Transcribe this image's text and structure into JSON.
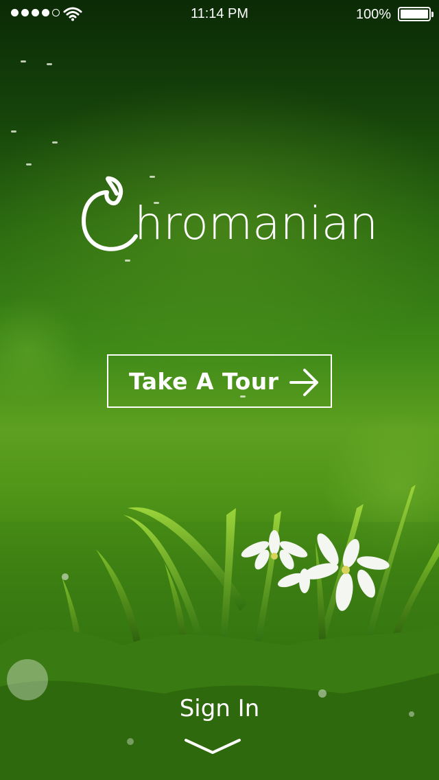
{
  "status_bar": {
    "time": "11:14 PM",
    "battery_percent": "100%",
    "signal_bars_filled": 4,
    "signal_bars_total": 5,
    "icons": [
      "signal-dots-icon",
      "wifi-icon",
      "battery-icon"
    ]
  },
  "logo": {
    "initial": "C",
    "rest": "hromanian"
  },
  "tour_button": {
    "label": "Take A Tour",
    "icon": "arrow-right-icon"
  },
  "sign_in": {
    "label": "Sign In",
    "icon": "chevron-down-icon"
  },
  "colors": {
    "text": "#ffffff",
    "background_top": "#0b2a06",
    "background_mid": "#5ea020",
    "background_bottom": "#2a5e0c"
  }
}
